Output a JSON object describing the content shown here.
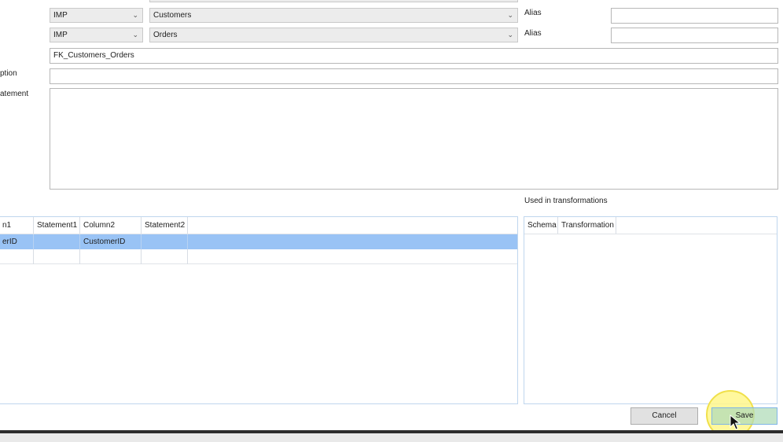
{
  "source": {
    "schema": "IMP",
    "table": "Customers",
    "alias_label": "Alias",
    "alias_value": ""
  },
  "target": {
    "schema": "IMP",
    "table": "Orders",
    "alias_label": "Alias",
    "alias_value": ""
  },
  "relationship_name": "FK_Customers_Orders",
  "description_label": "ption",
  "description_value": "",
  "statement_label": "atement",
  "statement_value": "",
  "columns_grid": {
    "headers": [
      "n1",
      "Statement1",
      "Column2",
      "Statement2"
    ],
    "rows": [
      [
        "erID",
        "",
        "CustomerID",
        ""
      ],
      [
        "",
        "",
        "",
        ""
      ]
    ],
    "selected_row": 0,
    "selection_color": "#99c3f5"
  },
  "transformations": {
    "title": "Used in transformations",
    "headers": [
      "Schema",
      "Transformation"
    ]
  },
  "buttons": {
    "cancel": "Cancel",
    "save": "Save"
  },
  "colors": {
    "save_bg": "#bfe3c4",
    "highlight": "#fff9a8"
  },
  "icons": {
    "dropdown": "chevron-down-icon",
    "cursor": "mouse-pointer-icon"
  }
}
